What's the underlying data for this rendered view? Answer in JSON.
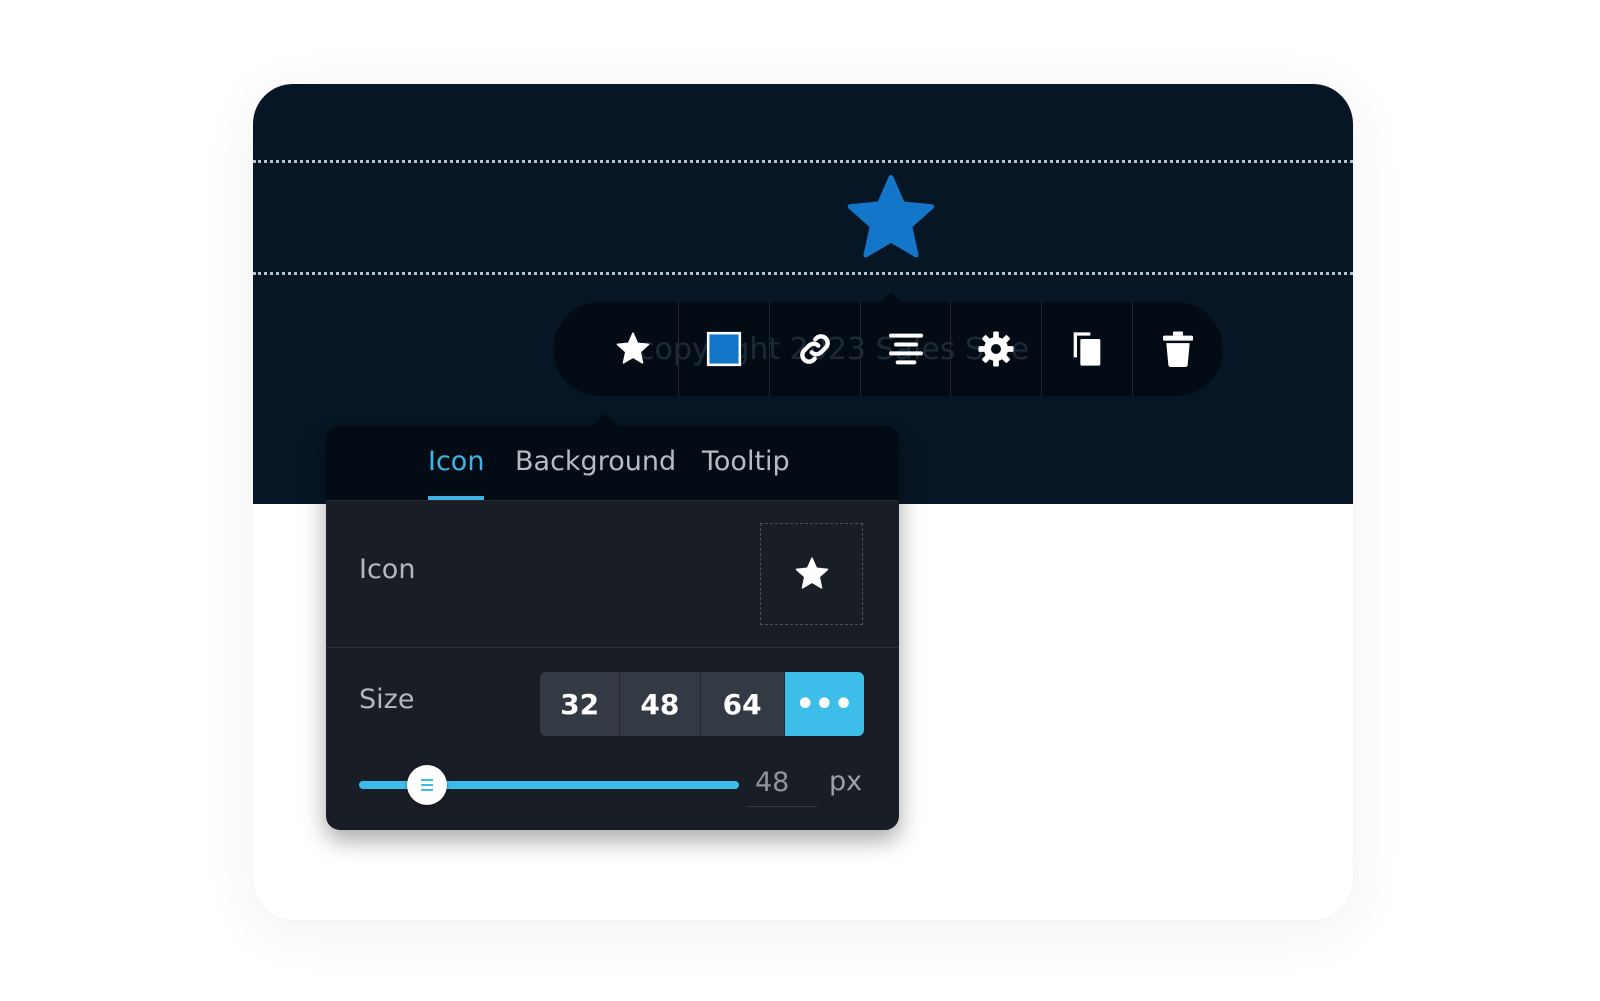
{
  "colors": {
    "dark_bg": "#071624",
    "toolbar_bg": "#030c15",
    "popup_bg": "#191d25",
    "accent": "#3dbde9",
    "star_blue": "#1376c8"
  },
  "toolbar": {
    "ghost_text": "copyright 2023 Sales Sale",
    "items": [
      {
        "name": "star-icon"
      },
      {
        "name": "square-icon"
      },
      {
        "name": "link-icon"
      },
      {
        "name": "align-center-icon"
      },
      {
        "name": "gear-icon"
      },
      {
        "name": "copy-icon"
      },
      {
        "name": "trash-icon"
      }
    ]
  },
  "popup": {
    "tabs": [
      {
        "label": "Icon",
        "active": true
      },
      {
        "label": "Background",
        "active": false
      },
      {
        "label": "Tooltip",
        "active": false
      }
    ],
    "icon_row": {
      "label": "Icon",
      "icon": "star-icon"
    },
    "size_row": {
      "label": "Size",
      "options": [
        "32",
        "48",
        "64"
      ],
      "more": "•••",
      "slider_fraction": 0.18,
      "value": "48",
      "unit": "px"
    }
  }
}
